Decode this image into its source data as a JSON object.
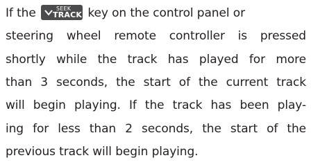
{
  "paragraph": {
    "line1_before": "If the",
    "key": {
      "icon": "chevron-down-icon",
      "top": "SEEK",
      "bottom": "TRACK"
    },
    "line1_after": "key on the control panel or",
    "line2": "steering wheel remote controller is pressed",
    "line3": "shortly while the track has played for more",
    "line4": "than 3 seconds, the start of the current track",
    "line5": "will begin playing. If the track has been play-",
    "line6": "ing for less than 2 seconds, the start of the",
    "line7": "previous track will begin playing."
  }
}
